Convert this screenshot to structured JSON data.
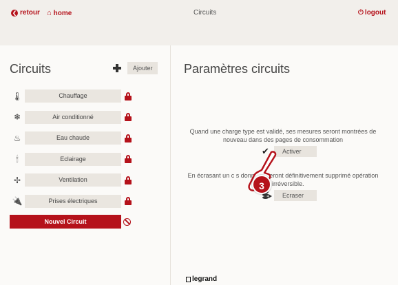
{
  "topbar": {
    "retour": "retour",
    "home": "home",
    "title": "Circuits",
    "logout": "logout"
  },
  "left": {
    "title": "Circuits",
    "add_label": "Ajouter",
    "circuits": [
      {
        "label": "Chauffage",
        "icon": "thermometer-icon"
      },
      {
        "label": "Air conditionné",
        "icon": "snowflake-icon"
      },
      {
        "label": "Eau chaude",
        "icon": "hot-water-icon"
      },
      {
        "label": "Eclairage",
        "icon": "lamp-icon"
      },
      {
        "label": "Ventilation",
        "icon": "fan-icon"
      },
      {
        "label": "Prises électriques",
        "icon": "plug-icon"
      }
    ],
    "new_circuit": "Nouvel Circuit"
  },
  "right": {
    "title": "Paramètres circuits",
    "text_activate": "Quand une charge type est validé, ses mesures seront montrées de nouveau dans des pages de consommation",
    "activate_label": "Activer",
    "text_erase": "En écrasant un c         s données seront définitivement supprimé           opération est irréversible.",
    "erase_label": "Ecraser",
    "step_badge": "3"
  },
  "footer": {
    "brand": "legrand"
  },
  "colors": {
    "accent": "#b5121b",
    "background": "#f2efeb",
    "panel": "#fbfaf8",
    "button": "#e8e4de"
  }
}
